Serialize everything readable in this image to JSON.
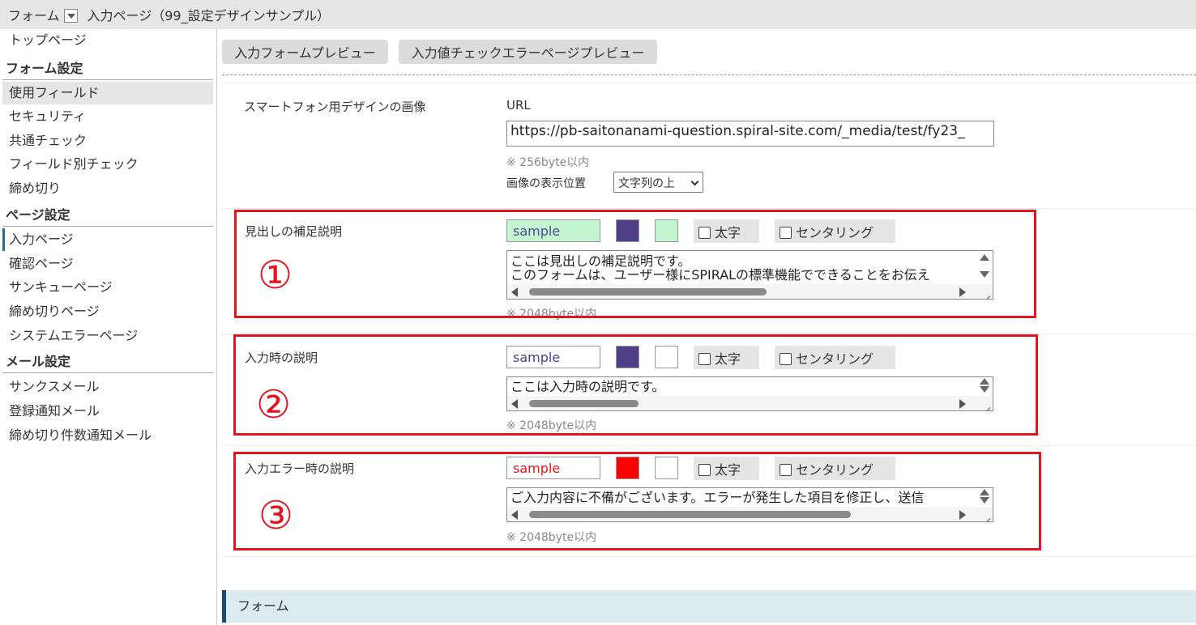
{
  "topbar": {
    "form_label": "フォーム",
    "page_title": "入力ページ（99_設定デザインサンプル）"
  },
  "sidebar": {
    "top": "トップページ",
    "sections": [
      {
        "title": "フォーム設定",
        "items": [
          "使用フィールド",
          "セキュリティ",
          "共通チェック",
          "フィールド別チェック",
          "締め切り"
        ]
      },
      {
        "title": "ページ設定",
        "items": [
          "入力ページ",
          "確認ページ",
          "サンキューページ",
          "締め切りページ",
          "システムエラーページ"
        ]
      },
      {
        "title": "メール設定",
        "items": [
          "サンクスメール",
          "登録通知メール",
          "締め切り件数通知メール"
        ]
      }
    ]
  },
  "toolbar": {
    "preview_form": "入力フォームプレビュー",
    "preview_error": "入力値チェックエラーページプレビュー"
  },
  "sp_image": {
    "label": "スマートフォン用デザインの画像",
    "url_label": "URL",
    "url_value": "https://pb-saitonanami-question.spiral-site.com/_media/test/fy23_",
    "note": "※ 256byte以内",
    "position_label": "画像の表示位置",
    "position_value": "文字列の上"
  },
  "rows": [
    {
      "label": "見出しの補足説明",
      "sample": "sample",
      "sample_color": "#4e4a8f",
      "sample_bg": "#c3f5d0",
      "swatch1": "#503f86",
      "swatch2": "#c3f5d0",
      "bold": "太字",
      "center": "センタリング",
      "line1": "ここは見出しの補足説明です。",
      "line2": "このフォームは、ユーザー様にSPIRALの標準機能でできることをお伝え",
      "note": "※ 2048byte以内",
      "number": "①"
    },
    {
      "label": "入力時の説明",
      "sample": "sample",
      "sample_color": "#4e3f86",
      "sample_bg": "#ffffff",
      "swatch1": "#503f86",
      "swatch2": "#ffffff",
      "bold": "太字",
      "center": "センタリング",
      "line1": "ここは入力時の説明です。",
      "note": "※ 2048byte以内",
      "number": "②"
    },
    {
      "label": "入力エラー時の説明",
      "sample": "sample",
      "sample_color": "#e0151f",
      "sample_bg": "#ffffff",
      "swatch1": "#ff0000",
      "swatch2": "#ffffff",
      "bold": "太字",
      "center": "センタリング",
      "line1": "ご入力内容に不備がございます。エラーが発生した項目を修正し、送信",
      "note": "※ 2048byte以内",
      "number": "③"
    }
  ],
  "section_bar": "フォーム",
  "colors": {
    "accent": "#1f4a66",
    "highlight": "#e0151f",
    "section_bg": "#dcebf0"
  }
}
